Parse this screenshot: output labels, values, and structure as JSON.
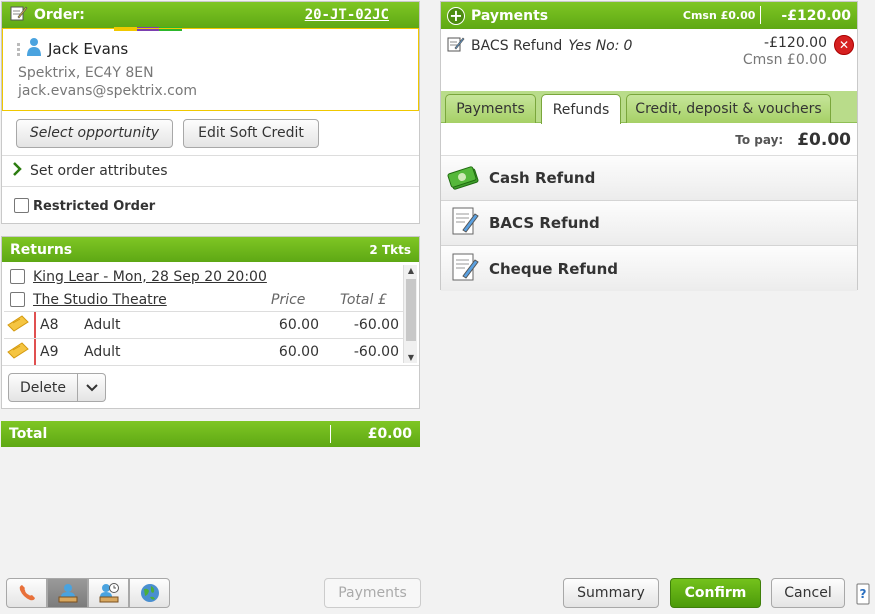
{
  "order": {
    "title": "Order:",
    "reference": "20-JT-02JC",
    "customer_name": "Jack Evans",
    "address": "Spektrix, EC4Y 8EN",
    "email": "jack.evans@spektrix.com",
    "select_opportunity": "Select opportunity",
    "edit_soft_credit": "Edit Soft Credit",
    "set_attributes": "Set order attributes",
    "restricted": "Restricted Order"
  },
  "returns": {
    "title": "Returns",
    "tickets": "2 Tkts",
    "event": "King Lear - Mon, 28 Sep 20 20:00",
    "venue": "The Studio Theatre",
    "price_header": "Price",
    "total_header": "Total £",
    "rows": [
      {
        "seat": "A8",
        "type": "Adult",
        "price": "60.00",
        "total": "-60.00"
      },
      {
        "seat": "A9",
        "type": "Adult",
        "price": "60.00",
        "total": "-60.00"
      }
    ],
    "delete": "Delete"
  },
  "total": {
    "label": "Total",
    "value": "£0.00"
  },
  "payments": {
    "title": "Payments",
    "cmsn": "Cmsn £0.00",
    "amount": "-£120.00",
    "line": {
      "method": "BACS Refund",
      "yes_no_label": "Yes No:",
      "yes_no_value": "0",
      "amount": "-£120.00",
      "cmsn": "Cmsn £0.00"
    },
    "tabs": [
      "Payments",
      "Refunds",
      "Credit, deposit & vouchers"
    ],
    "active_tab": "Refunds",
    "to_pay_label": "To pay:",
    "to_pay_value": "£0.00",
    "methods": [
      "Cash Refund",
      "BACS Refund",
      "Cheque Refund"
    ]
  },
  "toolbar": {
    "payments": "Payments",
    "summary": "Summary",
    "confirm": "Confirm",
    "cancel": "Cancel"
  },
  "colors": {
    "green": "#6cb61c",
    "strip": [
      "#f0c800",
      "#7b3fb0",
      "#2cb72c"
    ],
    "error_red": "#d62020"
  }
}
